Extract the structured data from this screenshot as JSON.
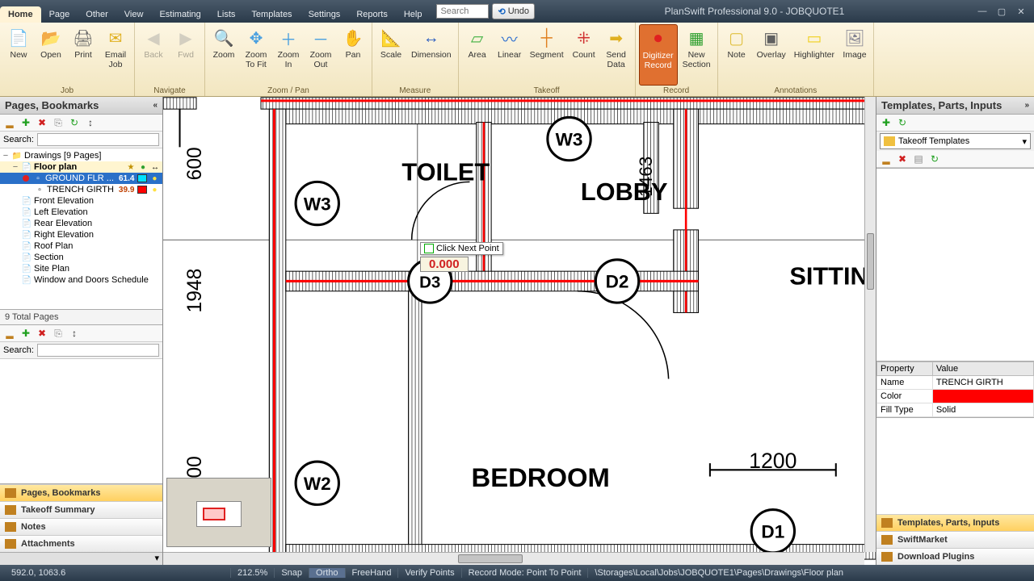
{
  "app": {
    "title": "PlanSwift Professional 9.0 - JOBQUOTE1"
  },
  "menu_tabs": [
    "Home",
    "Page",
    "Other",
    "View",
    "Estimating",
    "Lists",
    "Templates",
    "Settings",
    "Reports",
    "Help"
  ],
  "menu_active": 0,
  "quick": {
    "search_placeholder": "Search",
    "undo": "Undo"
  },
  "ribbon": {
    "groups": [
      {
        "label": "Job",
        "buttons": [
          {
            "name": "new",
            "label": "New",
            "icon": "📄",
            "color": "#2090e0"
          },
          {
            "name": "open",
            "label": "Open",
            "icon": "📂",
            "color": "#e0a020"
          },
          {
            "name": "print",
            "label": "Print",
            "icon": "🖨",
            "color": "#666"
          },
          {
            "name": "email-job",
            "label": "Email\nJob",
            "icon": "✉",
            "color": "#e0b020"
          }
        ]
      },
      {
        "label": "Navigate",
        "buttons": [
          {
            "name": "back",
            "label": "Back",
            "icon": "◀",
            "color": "#9a9a9a",
            "disabled": true
          },
          {
            "name": "fwd",
            "label": "Fwd",
            "icon": "▶",
            "color": "#9a9a9a",
            "disabled": true
          }
        ]
      },
      {
        "label": "Zoom / Pan",
        "buttons": [
          {
            "name": "zoom",
            "label": "Zoom",
            "icon": "🔍",
            "color": "#4aa0e0"
          },
          {
            "name": "zoom-fit",
            "label": "Zoom\nTo Fit",
            "icon": "✥",
            "color": "#4aa0e0"
          },
          {
            "name": "zoom-in",
            "label": "Zoom\nIn",
            "icon": "＋",
            "color": "#4aa0e0"
          },
          {
            "name": "zoom-out",
            "label": "Zoom\nOut",
            "icon": "－",
            "color": "#4aa0e0"
          },
          {
            "name": "pan",
            "label": "Pan",
            "icon": "✋",
            "color": "#e0b050"
          }
        ]
      },
      {
        "label": "Measure",
        "buttons": [
          {
            "name": "scale",
            "label": "Scale",
            "icon": "📐",
            "color": "#30a030"
          },
          {
            "name": "dimension",
            "label": "Dimension",
            "icon": "↔",
            "color": "#3060c0"
          }
        ]
      },
      {
        "label": "Takeoff",
        "buttons": [
          {
            "name": "area",
            "label": "Area",
            "icon": "▱",
            "color": "#40b040"
          },
          {
            "name": "linear",
            "label": "Linear",
            "icon": "〰",
            "color": "#3070d0"
          },
          {
            "name": "segment",
            "label": "Segment",
            "icon": "┼",
            "color": "#e08020"
          },
          {
            "name": "count",
            "label": "Count",
            "icon": "⁜",
            "color": "#d03030"
          },
          {
            "name": "send-data",
            "label": "Send\nData",
            "icon": "➡",
            "color": "#e0b020"
          }
        ]
      },
      {
        "label": "Record",
        "buttons": [
          {
            "name": "digitizer",
            "label": "Digitizer\nRecord",
            "icon": "⏺",
            "color": "#e02020",
            "active": true
          },
          {
            "name": "new-section",
            "label": "New\nSection",
            "icon": "▦",
            "color": "#30a030"
          }
        ]
      },
      {
        "label": "Annotations",
        "buttons": [
          {
            "name": "note",
            "label": "Note",
            "icon": "▢",
            "color": "#e0c040"
          },
          {
            "name": "overlay",
            "label": "Overlay",
            "icon": "▣",
            "color": "#606060"
          },
          {
            "name": "highlighter",
            "label": "Highlighter",
            "icon": "▭",
            "color": "#f0d020"
          },
          {
            "name": "image",
            "label": "Image",
            "icon": "🖼",
            "color": "#808090"
          }
        ]
      }
    ]
  },
  "left": {
    "title": "Pages, Bookmarks",
    "search_label": "Search:",
    "root": "Drawings [9 Pages]",
    "floor_plan": "Floor plan",
    "ground_flr": {
      "label": "GROUND FLR ...",
      "val": "61.4"
    },
    "trench": {
      "label": "TRENCH GIRTH",
      "val": "39.9"
    },
    "pages": [
      "Front Elevation",
      "Left Elevation",
      "Rear Elevation",
      "Right Elevation",
      "Roof Plan",
      "Section",
      "Site Plan",
      "Window and Doors Schedule"
    ],
    "footer": "9 Total Pages",
    "accordion": [
      "Pages, Bookmarks",
      "Takeoff Summary",
      "Notes",
      "Attachments"
    ]
  },
  "canvas": {
    "labels": {
      "toilet": "TOILET",
      "lobby": "LOBBY",
      "bedroom": "BEDROOM",
      "sittin": "SITTIN"
    },
    "tags": {
      "w3": "W3",
      "w2": "W2",
      "d1": "D1",
      "d2": "D2",
      "d3": "D3"
    },
    "dims": {
      "d600": "600",
      "d1948": "1948",
      "d1463": "1463",
      "d1200": "1200",
      "d00": "00"
    },
    "hint": "Click Next Point",
    "measure": "0.000"
  },
  "right": {
    "title": "Templates, Parts, Inputs",
    "combo": "Takeoff Templates",
    "props_header": [
      "Property",
      "Value"
    ],
    "props": [
      {
        "k": "Name",
        "v": "TRENCH GIRTH"
      },
      {
        "k": "Color",
        "v": "#ff0000",
        "is_color": true
      },
      {
        "k": "Fill Type",
        "v": "Solid"
      }
    ],
    "accordion": [
      "Templates, Parts, Inputs",
      "SwiftMarket",
      "Download Plugins"
    ]
  },
  "status": {
    "coords": "592.0, 1063.6",
    "zoom": "212.5%",
    "toggles": [
      "Snap",
      "Ortho",
      "FreeHand",
      "Verify Points"
    ],
    "toggle_active": 1,
    "mode": "Record Mode: Point To Point",
    "path": "\\Storages\\Local\\Jobs\\JOBQUOTE1\\Pages\\Drawings\\Floor plan"
  }
}
